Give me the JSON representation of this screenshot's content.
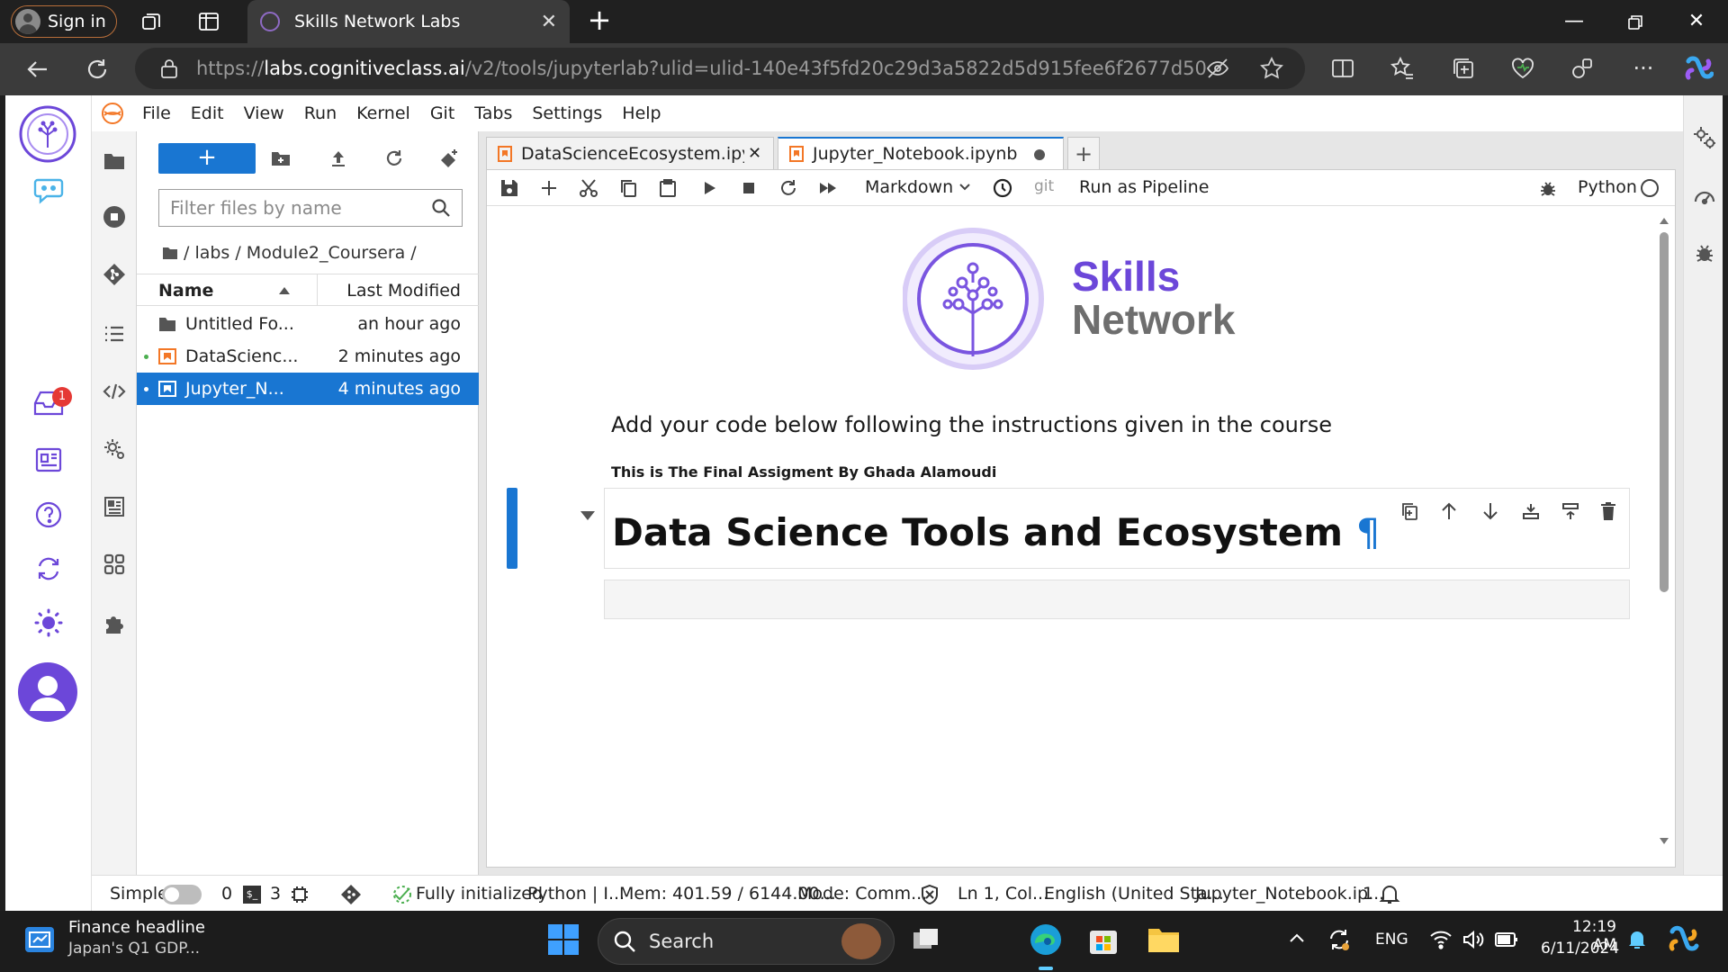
{
  "browser": {
    "signin_label": "Sign in",
    "tab_title": "Skills Network Labs",
    "url_prefix": "https://",
    "url_domain": "labs.cognitiveclass.ai",
    "url_path": "/v2/tools/jupyterlab?ulid=ulid-140e43f5fd20c29d3a5822d5d915fee6f2677d50"
  },
  "menubar": {
    "items": [
      "File",
      "Edit",
      "View",
      "Run",
      "Kernel",
      "Git",
      "Tabs",
      "Settings",
      "Help"
    ]
  },
  "rail": {
    "notification_count": "1"
  },
  "filebrowser": {
    "new_label": "+",
    "filter_placeholder": "Filter files by name",
    "breadcrumb": "/ labs / Module2_Coursera /",
    "col_name": "Name",
    "col_modified": "Last Modified",
    "rows": [
      {
        "name": "Untitled Fo...",
        "modified": "an hour ago",
        "type": "folder"
      },
      {
        "name": "DataScienc...",
        "modified": "2 minutes ago",
        "type": "notebook"
      },
      {
        "name": "Jupyter_N...",
        "modified": "4 minutes ago",
        "type": "notebook"
      }
    ]
  },
  "tabs": [
    {
      "label": "DataScienceEcosystem.ipynb"
    },
    {
      "label": "Jupyter_Notebook.ipynb"
    }
  ],
  "toolbar": {
    "cell_type": "Markdown",
    "git_label": "git",
    "pipeline_label": "Run as Pipeline",
    "kernel": "Python"
  },
  "notebook": {
    "logo_line1": "Skills",
    "logo_line2": "Network",
    "instruction": "Add your code below following the instructions given in the course",
    "author": "This is The Final Assigment By Ghada Alamoudi",
    "heading": "Data Science Tools and Ecosystem",
    "pilcrow": "¶"
  },
  "statusbar": {
    "mode": "Simple",
    "terminals": "0",
    "kernels": "3",
    "status": "Fully initialized",
    "kernel": "Python | I...",
    "mem": "Mem: 401.59 / 6144.00...",
    "cmd_mode": "Mode: Comm...",
    "position": "Ln 1, Col...",
    "language": "English (United Sta...",
    "file": "Jupyter_Notebook.ip...",
    "notif": "1"
  },
  "taskbar": {
    "news_title": "Finance headline",
    "news_sub": "Japan's Q1 GDP...",
    "search_label": "Search",
    "lang": "ENG",
    "time": "12:19 AM",
    "date": "6/11/2024"
  },
  "colors": {
    "accent": "#1976d2",
    "skills_purple": "#6c47d9",
    "skills_gray": "#6e6e6e"
  }
}
